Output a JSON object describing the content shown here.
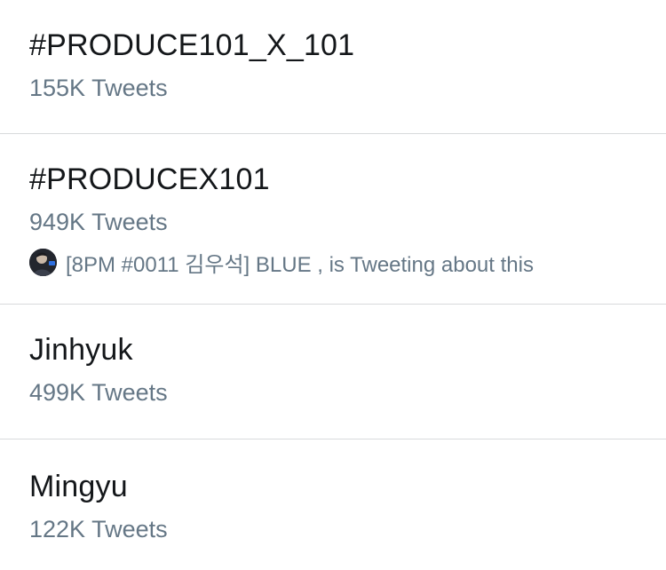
{
  "trends": [
    {
      "name": "#PRODUCE101_X_101",
      "count": "155K Tweets"
    },
    {
      "name": "#PRODUCEX101",
      "count": "949K Tweets",
      "context": {
        "text": "[8PM #0011 김우석] BLUE , is Tweeting about this",
        "avatar_icon": "user-avatar"
      }
    },
    {
      "name": "Jinhyuk",
      "count": "499K Tweets"
    },
    {
      "name": "Mingyu",
      "count": "122K Tweets"
    }
  ],
  "colors": {
    "primary_text": "#14171a",
    "secondary_text": "#657786",
    "divider": "#d8dadc",
    "background": "#ffffff"
  }
}
